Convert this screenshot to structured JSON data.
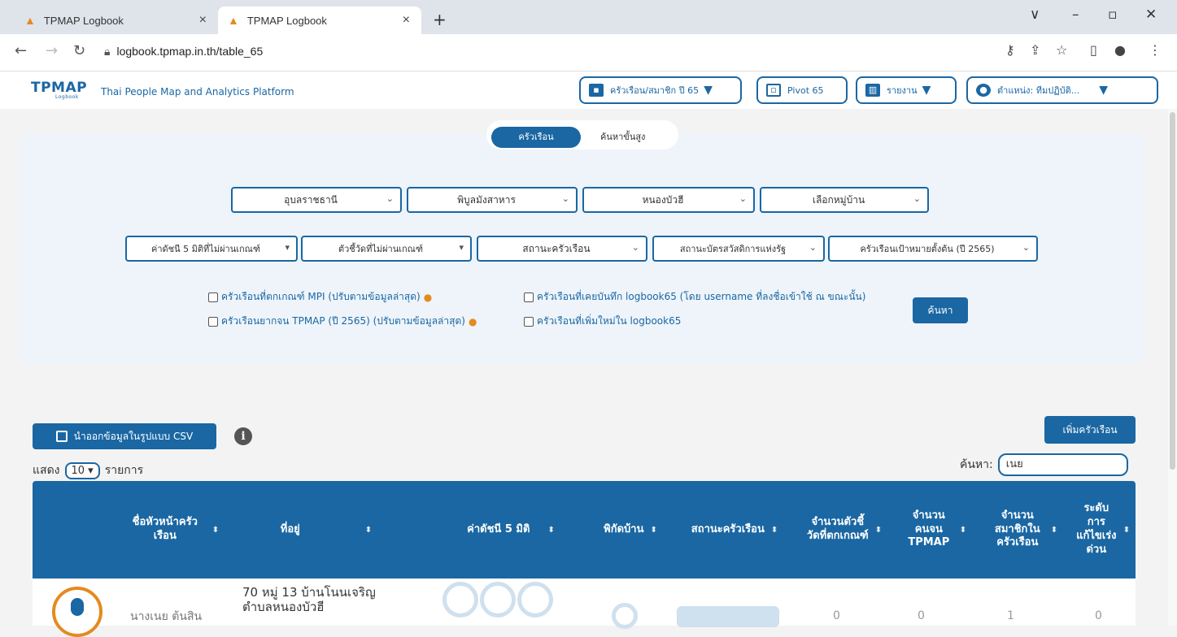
{
  "browser": {
    "tabs": [
      {
        "title": "TPMAP Logbook",
        "close": "×"
      },
      {
        "title": "TPMAP Logbook",
        "close": "×"
      }
    ],
    "new_tab": "+",
    "url": "logbook.tpmap.in.th/table_65",
    "window_controls": {
      "dropdown": "∨",
      "minimize": "–",
      "maximize": "▫",
      "close": "✕"
    }
  },
  "header": {
    "logo": "TPMAP",
    "logo_sub": "Logbook",
    "tagline": "Thai People Map and Analytics Platform",
    "menu_household": "ครัวเรือน/สมาชิก ปี 65",
    "menu_pivot": "Pivot 65",
    "menu_report": "รายงาน",
    "menu_role": "ตำแหน่ง: ทีมปฏิบัติ..."
  },
  "filters": {
    "mode_tabs": {
      "household": "ครัวเรือน",
      "advanced": "ค้นหาขั้นสูง"
    },
    "province": "อุบลราชธานี",
    "district": "พิบูลมังสาหาร",
    "subdistrict": "หนองบัวฮี",
    "village": "เลือกหมู่บ้าน",
    "mpi_index": "ค่าดัชนี 5 มิติที่ไม่ผ่านเกณฑ์",
    "indicator": "ตัวชี้วัดที่ไม่ผ่านเกณฑ์",
    "household_status": "สถานะครัวเรือน",
    "welfare_card": "สถานะบัตรสวัสดิการแห่งรัฐ",
    "target": "ครัวเรือนเป้าหมายตั้งต้น (ปี 2565)",
    "cb_mpi": "ครัวเรือนที่ตกเกณฑ์ MPI (ปรับตามข้อมูลล่าสุด)",
    "cb_poor": "ครัวเรือนยากจน TPMAP (ปี 2565) (ปรับตามข้อมูลล่าสุด)",
    "cb_recorded": "ครัวเรือนที่เคยบันทึก logbook65 (โดย username ที่ลงชื่อเข้าใช้ ณ ขณะนั้น)",
    "cb_new": "ครัวเรือนที่เพิ่มใหม่ใน logbook65",
    "search_button": "ค้นหา"
  },
  "table_controls": {
    "export_csv": "นำออกข้อมูลในรูปแบบ CSV",
    "add_household": "เพิ่มครัวเรือน",
    "show_prefix": "แสดง",
    "show_value": "10",
    "show_suffix": "รายการ",
    "search_label": "ค้นหา:",
    "search_value": "เนย"
  },
  "table": {
    "headers": [
      "ชื่อหัวหน้าครัวเรือน",
      "ที่อยู่",
      "ค่าดัชนี 5 มิติ",
      "พิกัดบ้าน",
      "สถานะครัวเรือน",
      "จำนวนตัวชี้วัดที่ตกเกณฑ์",
      "จำนวนคนจน TPMAP",
      "จำนวนสมาชิกในครัวเรือน",
      "ระดับการแก้ไขเร่งด่วน"
    ],
    "rows": [
      {
        "name": "นางเนย ต้นสิน",
        "address": "70 หมู่ 13 บ้านโนนเจริญ ตำบลหนองบัวฮี",
        "fail_count": "0",
        "tpmap_poor": "0",
        "members": "1",
        "urgent": "0"
      }
    ]
  },
  "colors": {
    "primary": "#1a67a3",
    "accent": "#e58a1f"
  }
}
